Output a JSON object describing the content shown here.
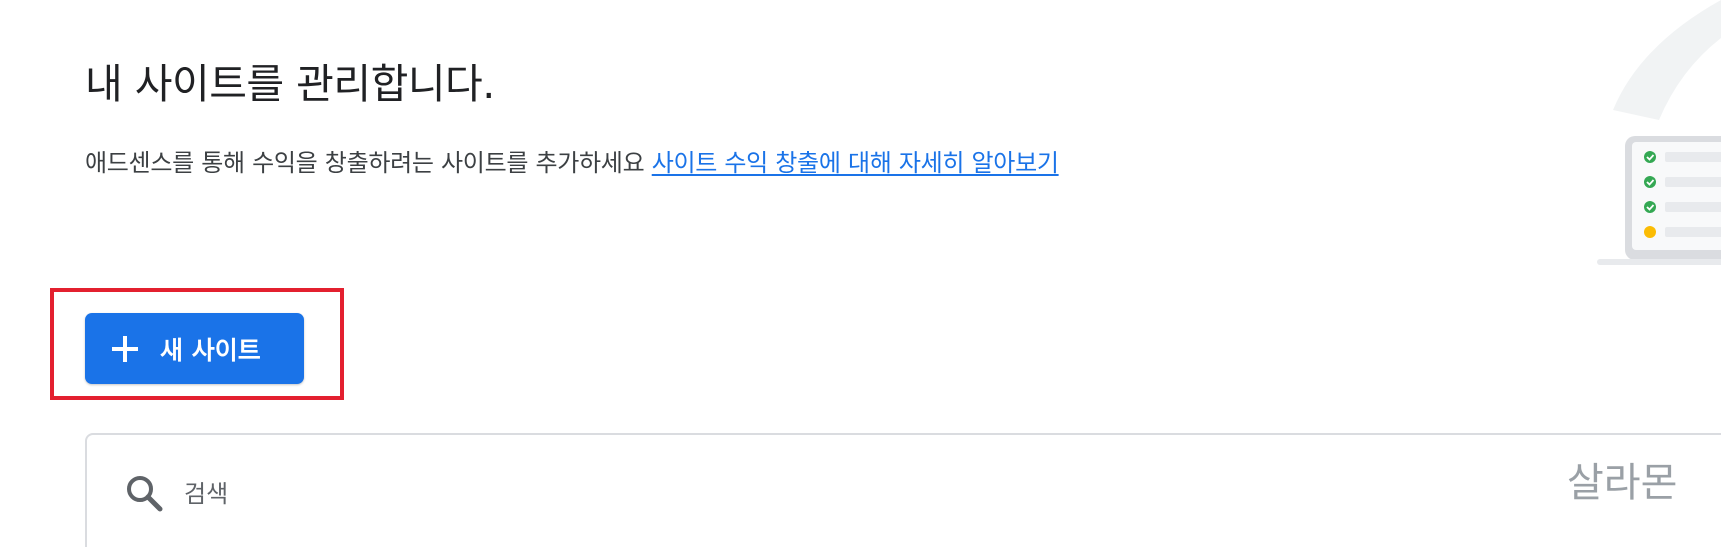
{
  "header": {
    "title": "내 사이트를 관리합니다.",
    "description": "애드센스를 통해 수익을 창출하려는 사이트를 추가하세요",
    "learn_more_link": "사이트 수익 창출에 대해 자세히 알아보기"
  },
  "actions": {
    "new_site_label": "새 사이트",
    "new_site_icon": "plus-icon"
  },
  "search": {
    "placeholder": "검색",
    "icon": "search-icon"
  },
  "watermark": {
    "text": "살라몬"
  },
  "illustration": {
    "checklist": [
      {
        "status": "done",
        "color": "#34a853"
      },
      {
        "status": "done",
        "color": "#34a853"
      },
      {
        "status": "done",
        "color": "#34a853"
      },
      {
        "status": "pending",
        "color": "#fbbc04"
      }
    ]
  },
  "colors": {
    "primary": "#1a73e8",
    "highlight_border": "#e3202f",
    "text_primary": "#202124",
    "text_secondary": "#3c4043"
  }
}
